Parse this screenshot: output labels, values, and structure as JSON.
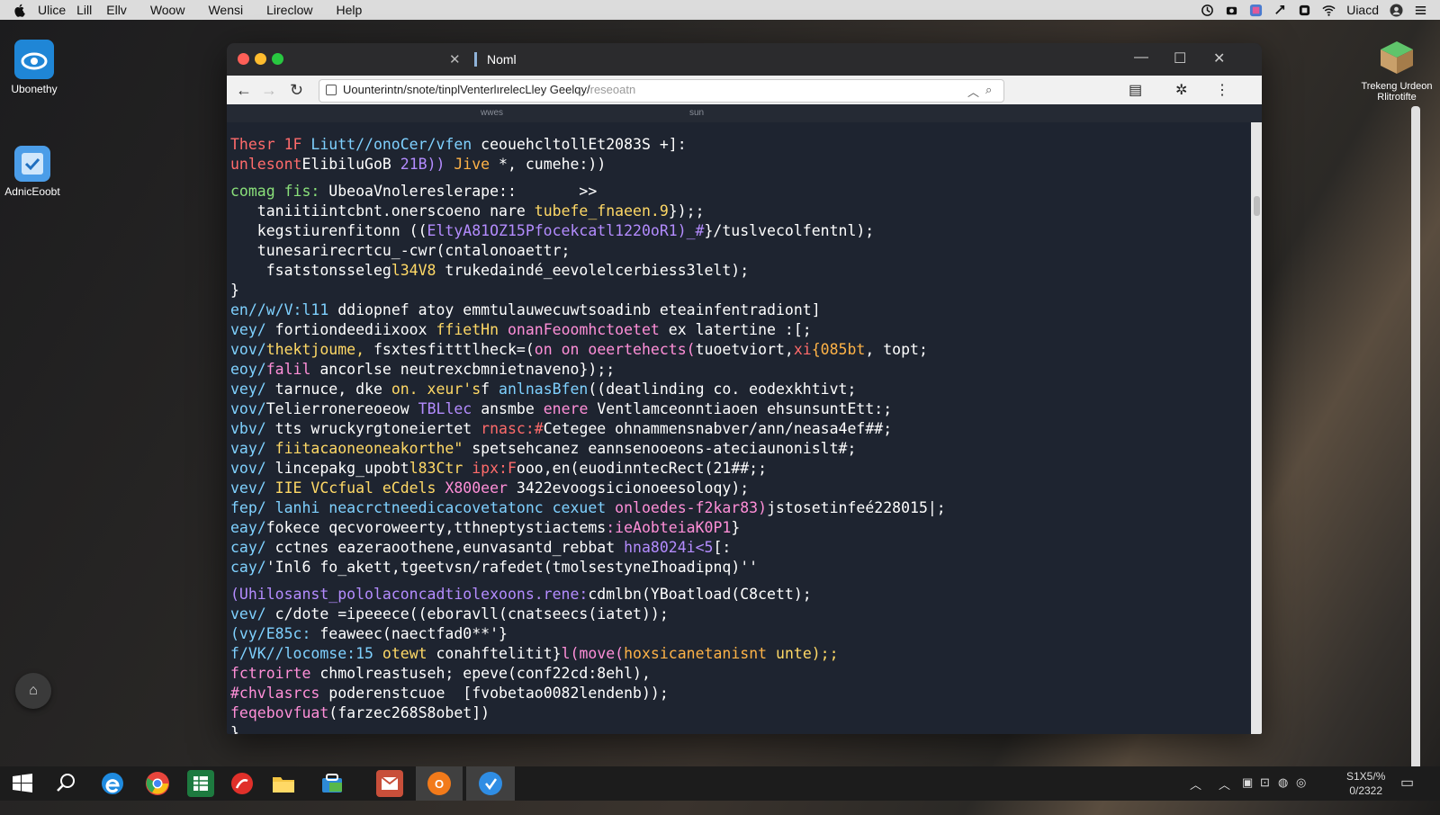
{
  "menubar": {
    "items": [
      "Ulice",
      "Lill",
      "Ellv",
      "Woow",
      "Wensi",
      "Lireclow",
      "Help"
    ],
    "status_name": "Uiacd"
  },
  "desktop": {
    "icons": [
      {
        "label": "Ubonethy",
        "icon": "eye-app-icon"
      },
      {
        "label": "AdnicEoobt",
        "icon": "book-app-icon"
      },
      {
        "label": "Trekeng Urdeon Rlitrotifte",
        "icon": "package-box-icon"
      }
    ]
  },
  "browser": {
    "tab_title": "Noml",
    "url": "Uounterintn/snote/tinplVenterlırelecLley Geelqy/",
    "url_faded": "reseoatn",
    "subheader": [
      "wwes",
      "sun"
    ]
  },
  "code_lines": [
    [
      {
        "t": "Thesr 1F ",
        "c": "#ff6b6b"
      },
      {
        "t": "Liutt//onoCer/vfen ",
        "c": "#7fd1ff"
      },
      {
        "t": "ceouehcltollEt2083S +]:",
        "c": "#ffffff"
      }
    ],
    [
      {
        "t": "unlesont",
        "c": "#ff6b6b"
      },
      {
        "t": "ElibiluGoB ",
        "c": "#ffffff"
      },
      {
        "t": "21B)) ",
        "c": "#b48cff"
      },
      {
        "t": "Jive ",
        "c": "#ffb347"
      },
      {
        "t": "*, cumehe:))",
        "c": "#ffffff"
      }
    ],
    [
      {
        "t": "",
        "c": "#ffffff"
      }
    ],
    [
      {
        "t": "comag fis: ",
        "c": "#8ae07a"
      },
      {
        "t": "UbeoaVnolereslerape::       >>",
        "c": "#ffffff"
      }
    ],
    [
      {
        "t": "   taniitiintcbnt.onerscoeno ",
        "c": "#ffffff"
      },
      {
        "t": "nare ",
        "c": "#ffffff"
      },
      {
        "t": "tubefe_fnaeen.9",
        "c": "#ffd966"
      },
      {
        "t": "});;",
        "c": "#ffffff"
      }
    ],
    [
      {
        "t": "   kegstiurenfitonn ((",
        "c": "#ffffff"
      },
      {
        "t": "EltyA81OZ15Pfocekcatl1220oR1)_#",
        "c": "#b48cff"
      },
      {
        "t": "}/tuslvecolfentnl);",
        "c": "#ffffff"
      }
    ],
    [
      {
        "t": "   tunesarirecrtcu_-cwr(cntalonoaettr;",
        "c": "#ffffff"
      }
    ],
    [
      {
        "t": "    fsatstonsseleg",
        "c": "#ffffff"
      },
      {
        "t": "l34V8 ",
        "c": "#ffd966"
      },
      {
        "t": "trukedaindé_eevolelcerbiess3lelt);",
        "c": "#ffffff"
      }
    ],
    [
      {
        "t": "}",
        "c": "#ffffff"
      }
    ],
    [
      {
        "t": "en//w/V:l11 ",
        "c": "#7fd1ff"
      },
      {
        "t": "ddiopnef atoy emmtulauwecuwtsoadinb eteainfentradiont]",
        "c": "#ffffff"
      }
    ],
    [
      {
        "t": "vey/ ",
        "c": "#7fd1ff"
      },
      {
        "t": "fortiondeediixoox ",
        "c": "#ffffff"
      },
      {
        "t": "ffietHn ",
        "c": "#ffd966"
      },
      {
        "t": "onanFeoomhctoetet ",
        "c": "#ff8fd8"
      },
      {
        "t": "ex latertine :[;",
        "c": "#ffffff"
      }
    ],
    [
      {
        "t": "vov/",
        "c": "#7fd1ff"
      },
      {
        "t": "thektjoume, ",
        "c": "#ffd966"
      },
      {
        "t": "fsxtesfitttlheck=(",
        "c": "#ffffff"
      },
      {
        "t": "on on oeertehects(",
        "c": "#ff8fd8"
      },
      {
        "t": "tuoetviort,",
        "c": "#ffffff"
      },
      {
        "t": "xi",
        "c": "#ff6b6b"
      },
      {
        "t": "{085bt",
        "c": "#ffb347"
      },
      {
        "t": ", topt;",
        "c": "#ffffff"
      }
    ],
    [
      {
        "t": "eoy/",
        "c": "#7fd1ff"
      },
      {
        "t": "falil ",
        "c": "#ff8fd8"
      },
      {
        "t": "ancorlse neutrexcbmnietnaveno",
        "c": "#ffffff"
      },
      {
        "t": "});;",
        "c": "#ffffff"
      }
    ],
    [
      {
        "t": "vey/ ",
        "c": "#7fd1ff"
      },
      {
        "t": "tarnuce, dke ",
        "c": "#ffffff"
      },
      {
        "t": "on. xeur's",
        "c": "#ffd966"
      },
      {
        "t": "f ",
        "c": "#ffffff"
      },
      {
        "t": "anlnasBfen",
        "c": "#7fd1ff"
      },
      {
        "t": "((deatlinding co. eodexkhtivt;",
        "c": "#ffffff"
      }
    ],
    [
      {
        "t": "vov/",
        "c": "#7fd1ff"
      },
      {
        "t": "Telierronereoeow ",
        "c": "#ffffff"
      },
      {
        "t": "TBLlec ",
        "c": "#b48cff"
      },
      {
        "t": "ansmbe ",
        "c": "#ffffff"
      },
      {
        "t": "enere ",
        "c": "#ff8fd8"
      },
      {
        "t": "Ventlamceonntiaoen ehsunsuntEtt:;",
        "c": "#ffffff"
      }
    ],
    [
      {
        "t": "vbv/ ",
        "c": "#7fd1ff"
      },
      {
        "t": "tts wruckyrgtoneiertet ",
        "c": "#ffffff"
      },
      {
        "t": "rnasc:#",
        "c": "#ff6b6b"
      },
      {
        "t": "Cetegee ohnammensnabver/ann/neasa4ef##;",
        "c": "#ffffff"
      }
    ],
    [
      {
        "t": "vay/ ",
        "c": "#7fd1ff"
      },
      {
        "t": "fiitacaoneoneakorthe\" ",
        "c": "#ffd966"
      },
      {
        "t": "spetsehcanez eannsenooeons-ateciaunonislt#;",
        "c": "#ffffff"
      }
    ],
    [
      {
        "t": "vov/ ",
        "c": "#7fd1ff"
      },
      {
        "t": "lincepakg_upobt",
        "c": "#ffffff"
      },
      {
        "t": "l83Ctr ",
        "c": "#ffd966"
      },
      {
        "t": "ipx:F",
        "c": "#ff6b6b"
      },
      {
        "t": "ooo,en(euodinntecRect(21##;;",
        "c": "#ffffff"
      }
    ],
    [
      {
        "t": "vev/ ",
        "c": "#7fd1ff"
      },
      {
        "t": "IIE VCcfual eCdels ",
        "c": "#ffd966"
      },
      {
        "t": "X800eer ",
        "c": "#ff8fd8"
      },
      {
        "t": "3422evoogsicionoeesoloqy);",
        "c": "#ffffff"
      }
    ],
    [
      {
        "t": "fep/ ",
        "c": "#7fd1ff"
      },
      {
        "t": "lanhi neacrctneedicacovetatonc cexuet ",
        "c": "#7fd1ff"
      },
      {
        "t": "onloedes-f2kar83)",
        "c": "#ff8fd8"
      },
      {
        "t": "jstosetinfeé228015|;",
        "c": "#ffffff"
      }
    ],
    [
      {
        "t": "eay/",
        "c": "#7fd1ff"
      },
      {
        "t": "fokece ",
        "c": "#ffffff"
      },
      {
        "t": "qecvoroweerty,tthneptystiactems",
        "c": "#ffffff"
      },
      {
        "t": ":ieAobteiaK0P1",
        "c": "#ff8fd8"
      },
      {
        "t": "}",
        "c": "#ffffff"
      }
    ],
    [
      {
        "t": "cay/ ",
        "c": "#7fd1ff"
      },
      {
        "t": "cctnes eazeraoothene,eunvasantd_rebbat ",
        "c": "#ffffff"
      },
      {
        "t": "hna8024i<5",
        "c": "#b48cff"
      },
      {
        "t": "[:",
        "c": "#ffffff"
      }
    ],
    [
      {
        "t": "cay/",
        "c": "#7fd1ff"
      },
      {
        "t": "'Inl6 ",
        "c": "#ffffff"
      },
      {
        "t": "fo_akett,tgeetvsn/rafedet(tmolsestyneIhoadipnq)''",
        "c": "#ffffff"
      }
    ],
    [
      {
        "t": "",
        "c": "#ffffff"
      }
    ],
    [
      {
        "t": "(Uhilosanst_pololaconcadtiolexoons.rene:",
        "c": "#b48cff"
      },
      {
        "t": "cdmlbn(YBoatload(C8cett);",
        "c": "#ffffff"
      }
    ],
    [
      {
        "t": "vev/ ",
        "c": "#7fd1ff"
      },
      {
        "t": "c/dote =ipeeece(",
        "c": "#ffffff"
      },
      {
        "t": "(eboravll(cnatseecs(iatet));",
        "c": "#ffffff"
      }
    ],
    [
      {
        "t": "(vy/E85c: ",
        "c": "#7fd1ff"
      },
      {
        "t": "feaweec(naectfad0**'}",
        "c": "#ffffff"
      }
    ],
    [
      {
        "t": "f/VK//locomse:15 ",
        "c": "#7fd1ff"
      },
      {
        "t": "otewt ",
        "c": "#ffd966"
      },
      {
        "t": "conahftelitit}",
        "c": "#ffffff"
      },
      {
        "t": "l(move(",
        "c": "#ff8fd8"
      },
      {
        "t": "hoxsicanetanisnt ",
        "c": "#ffb347"
      },
      {
        "t": "unte);;",
        "c": "#ffd966"
      }
    ],
    [
      {
        "t": "fctroirte ",
        "c": "#ff8fd8"
      },
      {
        "t": "chmolreastuseh; epeve(conf22cd:8ehl),",
        "c": "#ffffff"
      }
    ],
    [
      {
        "t": "#chvlasrcs ",
        "c": "#ff8fd8"
      },
      {
        "t": "poderenstcuoe  [fvobetao0082lendenb));",
        "c": "#ffffff"
      }
    ],
    [
      {
        "t": "feqebovfuat",
        "c": "#ff8fd8"
      },
      {
        "t": "(farzec268S8obet])",
        "c": "#ffffff"
      }
    ],
    [
      {
        "t": "}",
        "c": "#ffffff"
      }
    ]
  ],
  "taskbar": {
    "apps": [
      "windows-start-icon",
      "search-icon",
      "edge-icon",
      "chrome-icon",
      "spreadsheet-icon",
      "pdf-icon",
      "folder-icon",
      "store-icon",
      "mail-icon",
      "office-icon",
      "browser-blue-icon"
    ],
    "clock_top": "S1X5/%",
    "clock_bottom": "0/2322"
  }
}
